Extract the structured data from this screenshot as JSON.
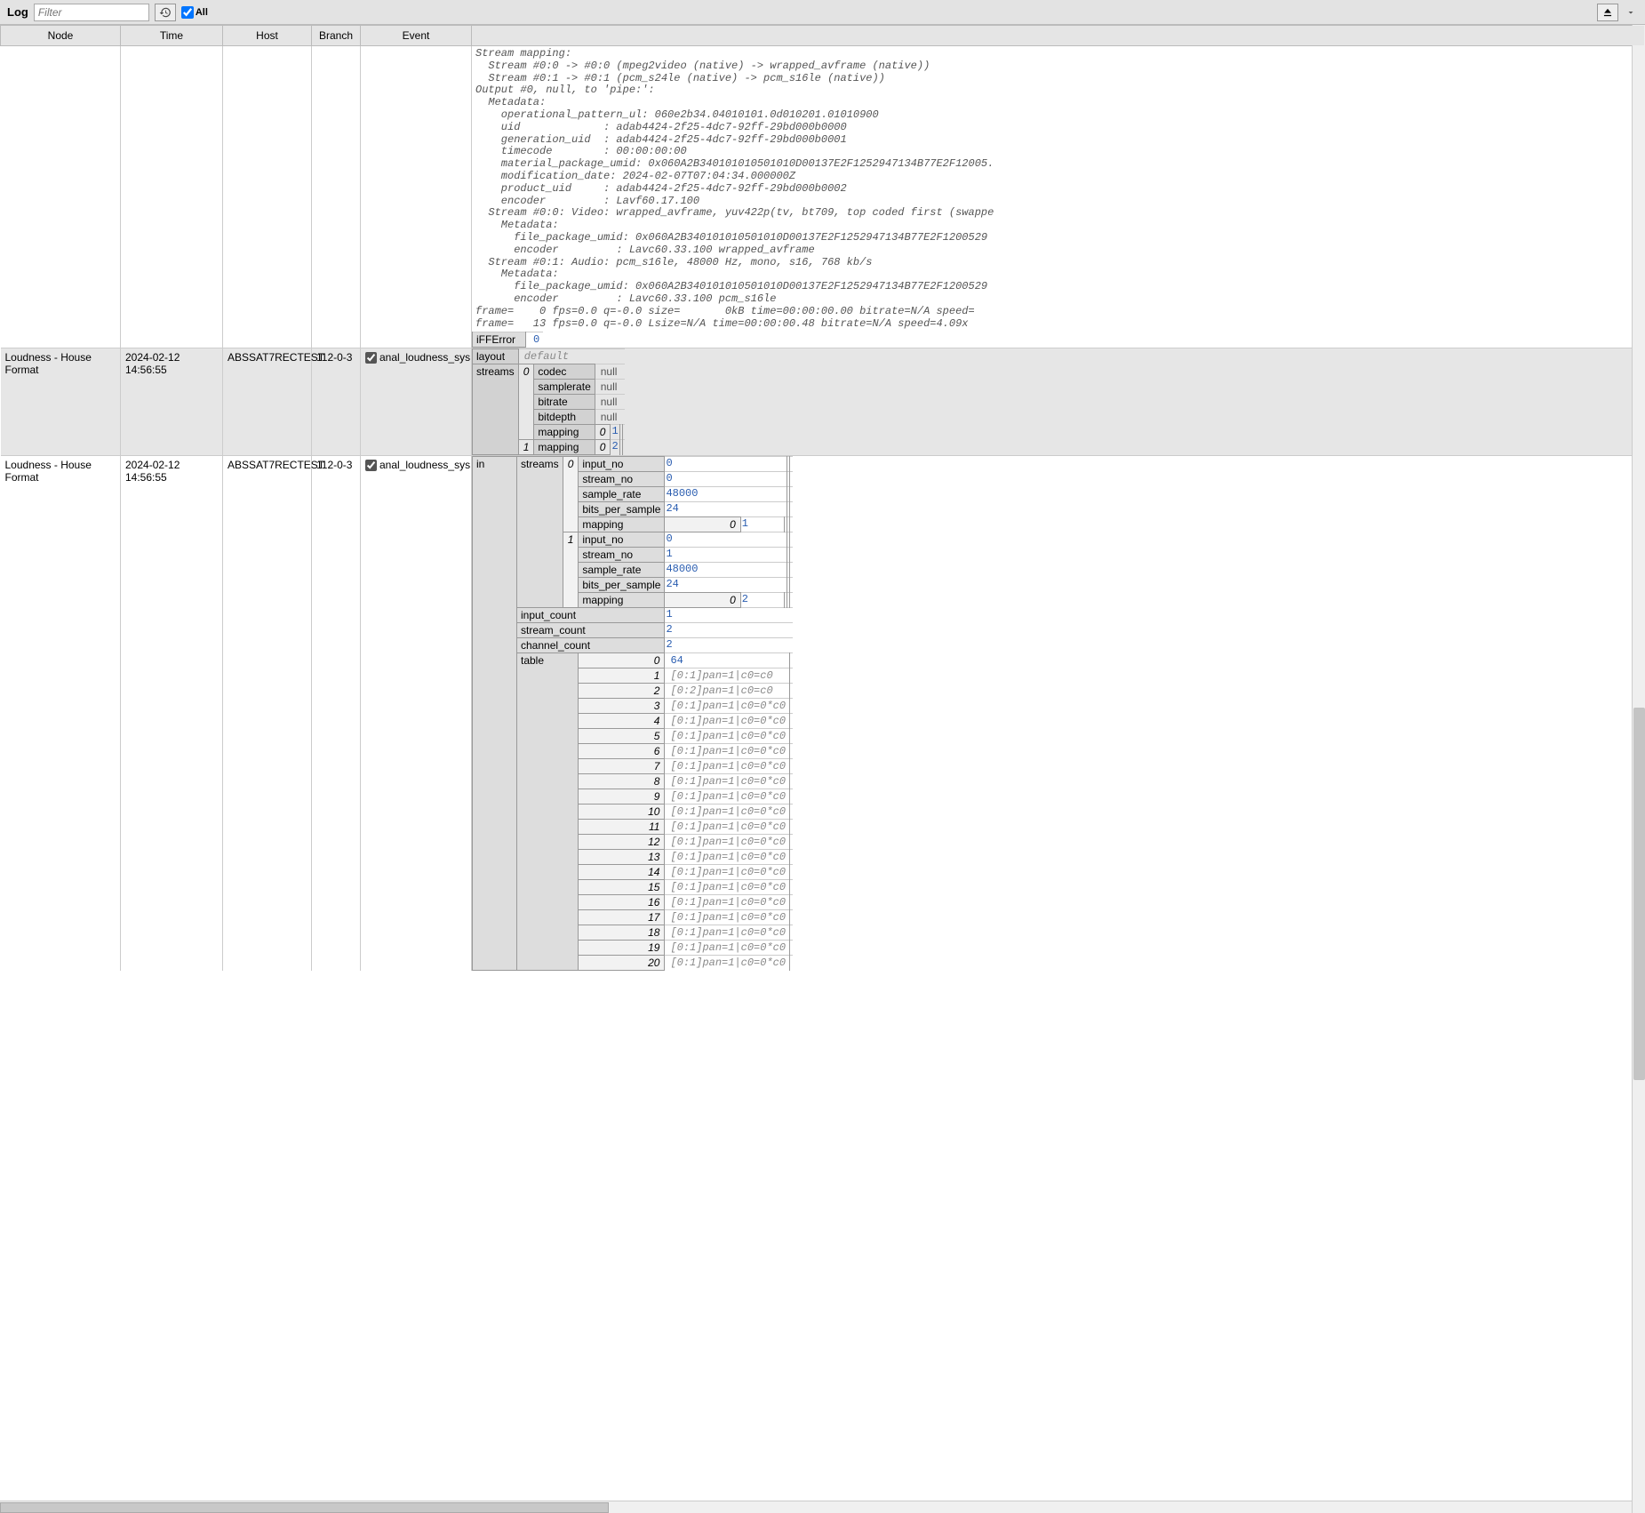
{
  "toolbar": {
    "title": "Log",
    "filter_placeholder": "Filter",
    "all_label": "All"
  },
  "columns": [
    "Node",
    "Time",
    "Host",
    "Branch",
    "Event",
    ""
  ],
  "rows": [
    {
      "node": "",
      "time": "",
      "host": "",
      "branch": "",
      "event_check": false,
      "event_label": "",
      "details": {
        "type": "ffmpeg",
        "text": "Stream mapping:\n  Stream #0:0 -> #0:0 (mpeg2video (native) -> wrapped_avframe (native))\n  Stream #0:1 -> #0:1 (pcm_s24le (native) -> pcm_s16le (native))\nOutput #0, null, to 'pipe:':\n  Metadata:\n    operational_pattern_ul: 060e2b34.04010101.0d010201.01010900\n    uid             : adab4424-2f25-4dc7-92ff-29bd000b0000\n    generation_uid  : adab4424-2f25-4dc7-92ff-29bd000b0001\n    timecode        : 00:00:00:00\n    material_package_umid: 0x060A2B340101010501010D00137E2F1252947134B77E2F12005.\n    modification_date: 2024-02-07T07:04:34.000000Z\n    product_uid     : adab4424-2f25-4dc7-92ff-29bd000b0002\n    encoder         : Lavf60.17.100\n  Stream #0:0: Video: wrapped_avframe, yuv422p(tv, bt709, top coded first (swappe\n    Metadata:\n      file_package_umid: 0x060A2B340101010501010D00137E2F1252947134B77E2F1200529\n      encoder         : Lavc60.33.100 wrapped_avframe\n  Stream #0:1: Audio: pcm_s16le, 48000 Hz, mono, s16, 768 kb/s\n    Metadata:\n      file_package_umid: 0x060A2B340101010501010D00137E2F1252947134B77E2F1200529\n      encoder         : Lavc60.33.100 pcm_s16le\nframe=    0 fps=0.0 q=-0.0 size=       0kB time=00:00:00.00 bitrate=N/A speed=\nframe=   13 fps=0.0 q=-0.0 Lsize=N/A time=00:00:00.48 bitrate=N/A speed=4.09x",
        "ifferror_label": "iFFError",
        "ifferror_val": "0"
      }
    },
    {
      "node": "Loudness - House Format",
      "time": "2024-02-12 14:56:55",
      "host": "ABSSAT7RECTEST",
      "branch": "112-0-3",
      "event_check": true,
      "event_label": "anal_loudness_sys",
      "details": {
        "type": "layout",
        "layout_label": "layout",
        "layout_val": "default",
        "streams_label": "streams",
        "streams": [
          {
            "idx": "0",
            "rows": [
              [
                "codec",
                "null"
              ],
              [
                "samplerate",
                "null"
              ],
              [
                "bitrate",
                "null"
              ],
              [
                "bitdepth",
                "null"
              ],
              [
                "mapping",
                {
                  "idx": "0",
                  "val": "1"
                }
              ]
            ]
          },
          {
            "idx": "1",
            "rows": [
              [
                "mapping",
                {
                  "idx": "0",
                  "val": "2"
                }
              ]
            ]
          }
        ]
      }
    },
    {
      "node": "Loudness - House Format",
      "time": "2024-02-12 14:56:55",
      "host": "ABSSAT7RECTEST",
      "branch": "112-0-3",
      "event_check": true,
      "event_label": "anal_loudness_sys",
      "details": {
        "type": "in",
        "in_label": "in",
        "streams_label": "streams",
        "streams": [
          {
            "idx": "0",
            "rows": [
              [
                "input_no",
                "0"
              ],
              [
                "stream_no",
                "0"
              ],
              [
                "sample_rate",
                "48000"
              ],
              [
                "bits_per_sample",
                "24"
              ],
              [
                "mapping",
                {
                  "idx": "0",
                  "val": "1"
                }
              ]
            ]
          },
          {
            "idx": "1",
            "rows": [
              [
                "input_no",
                "0"
              ],
              [
                "stream_no",
                "1"
              ],
              [
                "sample_rate",
                "48000"
              ],
              [
                "bits_per_sample",
                "24"
              ],
              [
                "mapping",
                {
                  "idx": "0",
                  "val": "2"
                }
              ]
            ]
          }
        ],
        "input_count_label": "input_count",
        "input_count_val": "1",
        "stream_count_label": "stream_count",
        "stream_count_val": "2",
        "channel_count_label": "channel_count",
        "channel_count_val": "2",
        "table_label": "table",
        "table": [
          {
            "idx": "0",
            "val": "64",
            "blue": true
          },
          {
            "idx": "1",
            "val": "[0:1]pan=1|c0=c0"
          },
          {
            "idx": "2",
            "val": "[0:2]pan=1|c0=c0"
          },
          {
            "idx": "3",
            "val": "[0:1]pan=1|c0=0*c0"
          },
          {
            "idx": "4",
            "val": "[0:1]pan=1|c0=0*c0"
          },
          {
            "idx": "5",
            "val": "[0:1]pan=1|c0=0*c0"
          },
          {
            "idx": "6",
            "val": "[0:1]pan=1|c0=0*c0"
          },
          {
            "idx": "7",
            "val": "[0:1]pan=1|c0=0*c0"
          },
          {
            "idx": "8",
            "val": "[0:1]pan=1|c0=0*c0"
          },
          {
            "idx": "9",
            "val": "[0:1]pan=1|c0=0*c0"
          },
          {
            "idx": "10",
            "val": "[0:1]pan=1|c0=0*c0"
          },
          {
            "idx": "11",
            "val": "[0:1]pan=1|c0=0*c0"
          },
          {
            "idx": "12",
            "val": "[0:1]pan=1|c0=0*c0"
          },
          {
            "idx": "13",
            "val": "[0:1]pan=1|c0=0*c0"
          },
          {
            "idx": "14",
            "val": "[0:1]pan=1|c0=0*c0"
          },
          {
            "idx": "15",
            "val": "[0:1]pan=1|c0=0*c0"
          },
          {
            "idx": "16",
            "val": "[0:1]pan=1|c0=0*c0"
          },
          {
            "idx": "17",
            "val": "[0:1]pan=1|c0=0*c0"
          },
          {
            "idx": "18",
            "val": "[0:1]pan=1|c0=0*c0"
          },
          {
            "idx": "19",
            "val": "[0:1]pan=1|c0=0*c0"
          },
          {
            "idx": "20",
            "val": "[0:1]pan=1|c0=0*c0"
          }
        ]
      }
    }
  ]
}
